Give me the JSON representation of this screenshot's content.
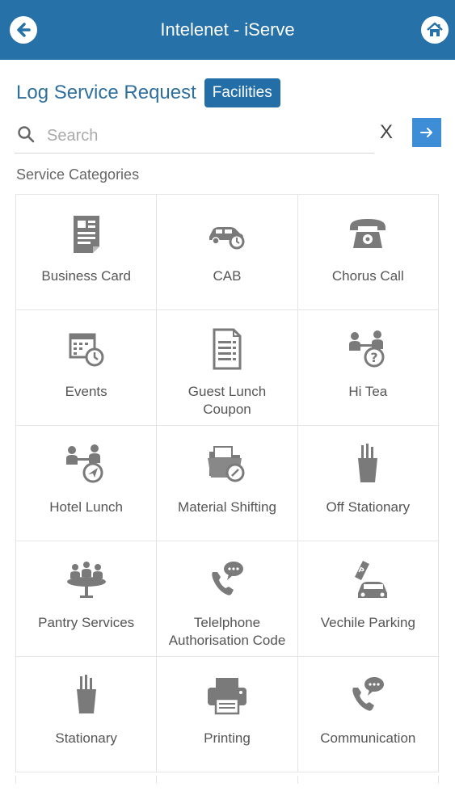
{
  "header": {
    "title": "Intelenet - iServe"
  },
  "page": {
    "heading": "Log Service Request",
    "tag": "Facilities"
  },
  "search": {
    "placeholder": "Search",
    "value": "",
    "clear_label": "X"
  },
  "section_label": "Service Categories",
  "colors": {
    "header_bg": "#2571a8",
    "accent": "#2e6f9e",
    "tag_bg": "#246ea8",
    "go_btn": "#3d8ed6",
    "icon": "#7a7a7a"
  },
  "categories": [
    {
      "label": "Business Card",
      "icon": "business-card-icon"
    },
    {
      "label": "CAB",
      "icon": "cab-icon"
    },
    {
      "label": "Chorus Call",
      "icon": "telephone-icon"
    },
    {
      "label": "Events",
      "icon": "calendar-clock-icon"
    },
    {
      "label": "Guest Lunch Coupon",
      "icon": "document-list-icon"
    },
    {
      "label": "Hi Tea",
      "icon": "meeting-question-icon"
    },
    {
      "label": "Hotel Lunch",
      "icon": "meeting-plane-icon"
    },
    {
      "label": "Material Shifting",
      "icon": "folder-clock-icon"
    },
    {
      "label": "Off Stationary",
      "icon": "pencil-cup-icon"
    },
    {
      "label": "Pantry Services",
      "icon": "pantry-table-icon"
    },
    {
      "label": "Telelphone Authorisation Code",
      "icon": "phone-chat-icon"
    },
    {
      "label": "Vechile Parking",
      "icon": "parking-car-icon"
    },
    {
      "label": "Stationary",
      "icon": "pencil-cup-icon"
    },
    {
      "label": "Printing",
      "icon": "printer-icon"
    },
    {
      "label": "Communication",
      "icon": "phone-chat-icon"
    }
  ]
}
